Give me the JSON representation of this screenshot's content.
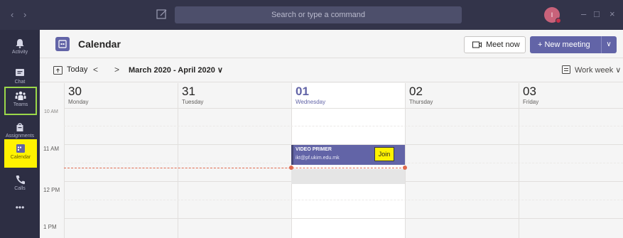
{
  "titlebar": {
    "back": "‹",
    "forward": "›",
    "search_placeholder": "Search or type a command",
    "avatar_initial": "I",
    "minimize": "–",
    "maximize": "□",
    "close": "×"
  },
  "rail": {
    "items": [
      {
        "label": "Activity",
        "icon": "bell-icon"
      },
      {
        "label": "Chat",
        "icon": "chat-icon"
      },
      {
        "label": "Teams",
        "icon": "teams-icon"
      },
      {
        "label": "Assignments",
        "icon": "assignments-icon"
      },
      {
        "label": "Calendar",
        "icon": "calendar-icon"
      },
      {
        "label": "Calls",
        "icon": "phone-icon"
      }
    ],
    "more": "•••",
    "highlight_green": "#9bd84a",
    "highlight_yellow": "#fff200"
  },
  "header": {
    "title": "Calendar",
    "meet_now": "Meet now",
    "new_meeting": "+ New meeting",
    "new_meeting_chevron": "∨"
  },
  "toolbar": {
    "today": "Today",
    "prev": "<",
    "next": ">",
    "range": "March 2020 - April 2020 ∨",
    "view": "Work week ∨"
  },
  "days": [
    {
      "num": "30",
      "name": "Monday"
    },
    {
      "num": "31",
      "name": "Tuesday"
    },
    {
      "num": "01",
      "name": "Wednesday",
      "today": true
    },
    {
      "num": "02",
      "name": "Thursday"
    },
    {
      "num": "03",
      "name": "Friday"
    }
  ],
  "times": {
    "partial": "10 AM",
    "t11": "11 AM",
    "t12": "12 PM",
    "t1": "1 PM"
  },
  "event": {
    "title": "VIDEO PRIMER",
    "organizer": "ikt@pf.ukim.edu.mk",
    "join": "Join"
  },
  "colors": {
    "accent": "#6264a7",
    "titlebar": "#33344a",
    "rail": "#2d2e43",
    "now_line": "#e06a4f"
  }
}
